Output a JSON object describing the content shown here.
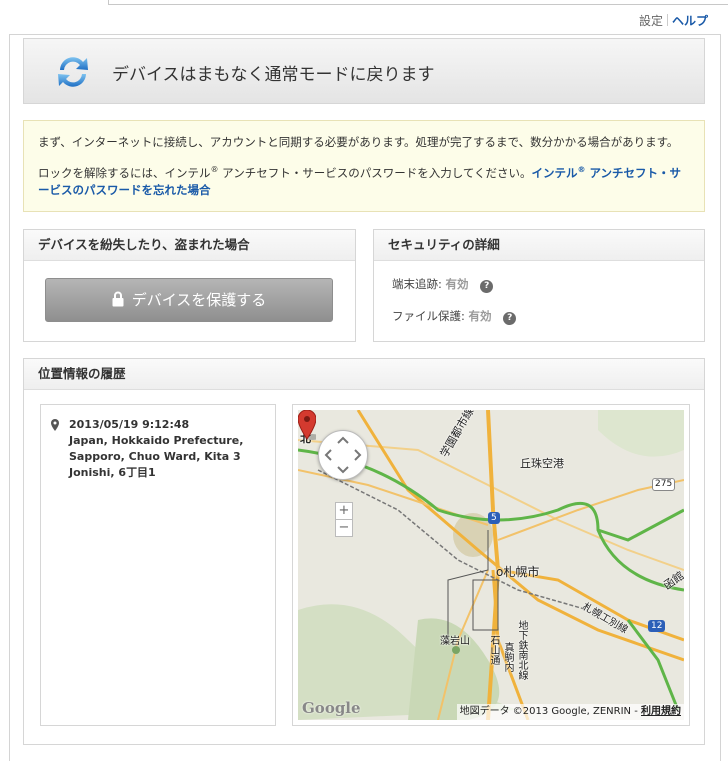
{
  "header": {
    "settings_label": "設定",
    "help_label": "ヘルプ"
  },
  "banner": {
    "title": "デバイスはまもなく通常モードに戻ります",
    "icon": "sync-icon"
  },
  "notice": {
    "line1": "まず、インターネットに接続し、アカウントと同期する必要があります。処理が完了するまで、数分かかる場合があります。",
    "line2_prefix": "ロックを解除するには、インテル",
    "line2_mid": " アンチセフト・サービスのパスワードを入力してください。",
    "link_prefix": "インテル",
    "link_rest": " アンチセフト・サービスのパスワードを忘れた場合",
    "registered_mark": "®"
  },
  "lost_panel": {
    "title": "デバイスを紛失したり、盗まれた場合",
    "button_label": "デバイスを保護する",
    "button_icon": "lock-icon"
  },
  "security_panel": {
    "title": "セキュリティの詳細",
    "rows": [
      {
        "label": "端末追跡:",
        "value": "有効"
      },
      {
        "label": "ファイル保護:",
        "value": "有効"
      }
    ],
    "help_glyph": "?"
  },
  "location_panel": {
    "title": "位置情報の履歴",
    "entry": {
      "datetime": "2013/05/19 9:12:48",
      "line1": "Japan, Hokkaido Prefecture,",
      "line2": "Sapporo, Chuo Ward, Kita 3",
      "line3": "Jonishi, 6丁目1",
      "icon": "map-pin-icon"
    },
    "map": {
      "labels": {
        "north": "北",
        "gakuen": "学園都市線",
        "okadama": "丘珠空港",
        "route275": "275",
        "route5": "5",
        "sapporo": "o札幌市",
        "sapporo_kogyo": "札幌工別線",
        "hakodate": "函館",
        "route12": "12",
        "moiwa": "藻岩山",
        "ishiyama": "石山通",
        "makomanai": "真駒内",
        "subway": "地下鉄南北線"
      },
      "zoom_in": "+",
      "zoom_out": "−",
      "google": "Google",
      "credit": "地図データ ©2013 Google, ZENRIN - ",
      "terms": "利用規約",
      "colors": {
        "highway": "#f0b23c",
        "expressway": "#5fb548",
        "marker": "#d43a2f"
      }
    }
  }
}
